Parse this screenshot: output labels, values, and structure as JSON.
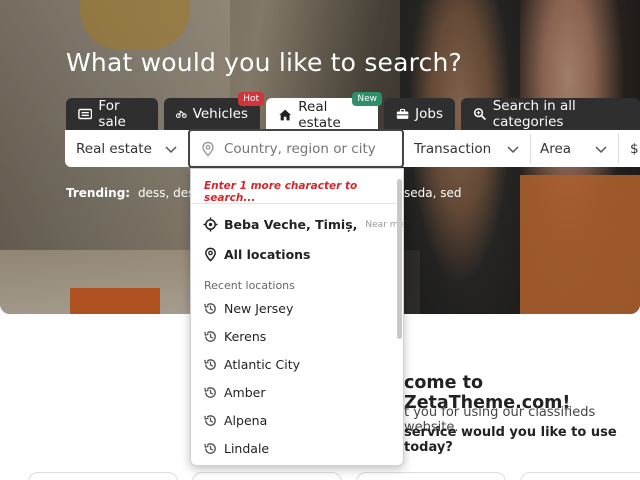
{
  "hero": {
    "headline": "What would you like to search?",
    "tabs": [
      {
        "label": "For sale",
        "icon": "list-icon",
        "badge": ""
      },
      {
        "label": "Vehicles",
        "icon": "motorcycle-icon",
        "badge": "Hot"
      },
      {
        "label": "Real estate",
        "icon": "home-icon",
        "badge": "New"
      },
      {
        "label": "Jobs",
        "icon": "briefcase-icon",
        "badge": ""
      },
      {
        "label": "Search in all categories",
        "icon": "search-icon",
        "badge": ""
      }
    ],
    "active_tab": "Real estate"
  },
  "search_bar": {
    "category_value": "Real estate",
    "location_placeholder": "Country, region or city",
    "transaction_value": "Transaction",
    "area_value": "Area",
    "price_symbol": "$"
  },
  "trending": {
    "label": "Trending:",
    "terms": "dess, desde,",
    "terms_tail": "seda, sed"
  },
  "location_dropdown": {
    "warning": "Enter 1 more character to search...",
    "current_location": "Beba Veche, Timiș,",
    "near_me": "Near me",
    "all_locations": "All locations",
    "recent_heading": "Recent locations",
    "recent": [
      "New Jersey",
      "Kerens",
      "Atlantic City",
      "Amber",
      "Alpena",
      "Lindale"
    ]
  },
  "welcome": {
    "title": "come to ZetaTheme.com!",
    "thanks": "t you for using our classifieds website.",
    "question": "service would you like to use today?"
  },
  "colors": {
    "warning_red": "#d8252a",
    "hot_badge": "#d4333a",
    "new_badge": "#2f8f6b",
    "tab_dark": "#2f2f2f"
  }
}
